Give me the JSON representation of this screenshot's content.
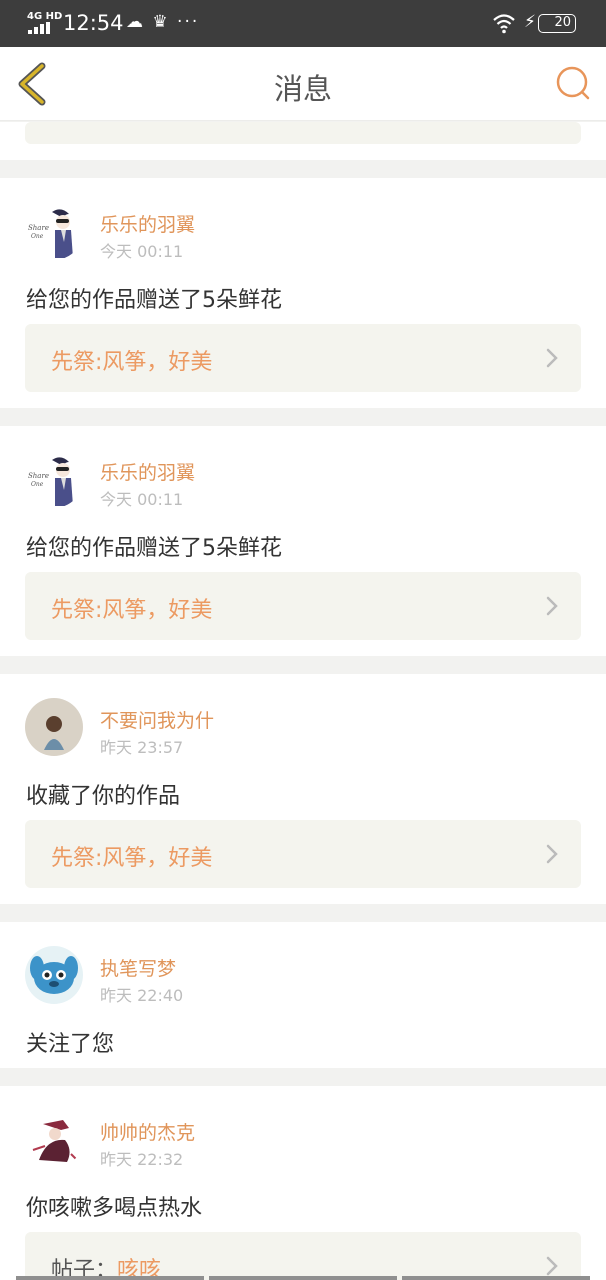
{
  "status_bar": {
    "network": "4G HD",
    "time": "12:54",
    "icons": "☁ ♛ ···",
    "battery": "20"
  },
  "header": {
    "title": "消息",
    "back_icon": "chevron-left-icon",
    "search_icon": "search-icon"
  },
  "colors": {
    "accent": "#e0955a",
    "back_icon": "#c9a11a",
    "quote_bg": "#f4f4ee",
    "page_bg": "#f2f2f0"
  },
  "messages": [
    {
      "user": "乐乐的羽翼",
      "time": "今天 00:11",
      "action": "给您的作品赠送了5朵鲜花",
      "quote": "先祭:风筝，好美"
    },
    {
      "user": "乐乐的羽翼",
      "time": "今天 00:11",
      "action": "给您的作品赠送了5朵鲜花",
      "quote": "先祭:风筝，好美"
    },
    {
      "user": "不要问我为什",
      "time": "昨天 23:57",
      "action": "收藏了你的作品",
      "quote": "先祭:风筝，好美"
    },
    {
      "user": "执笔写梦",
      "time": "昨天 22:40",
      "action": "关注了您"
    },
    {
      "user": "帅帅的杰克",
      "time": "昨天 22:32",
      "action": "你咳嗽多喝点热水",
      "quote_prefix": "帖子：",
      "quote_highlight": "咳咳"
    }
  ]
}
